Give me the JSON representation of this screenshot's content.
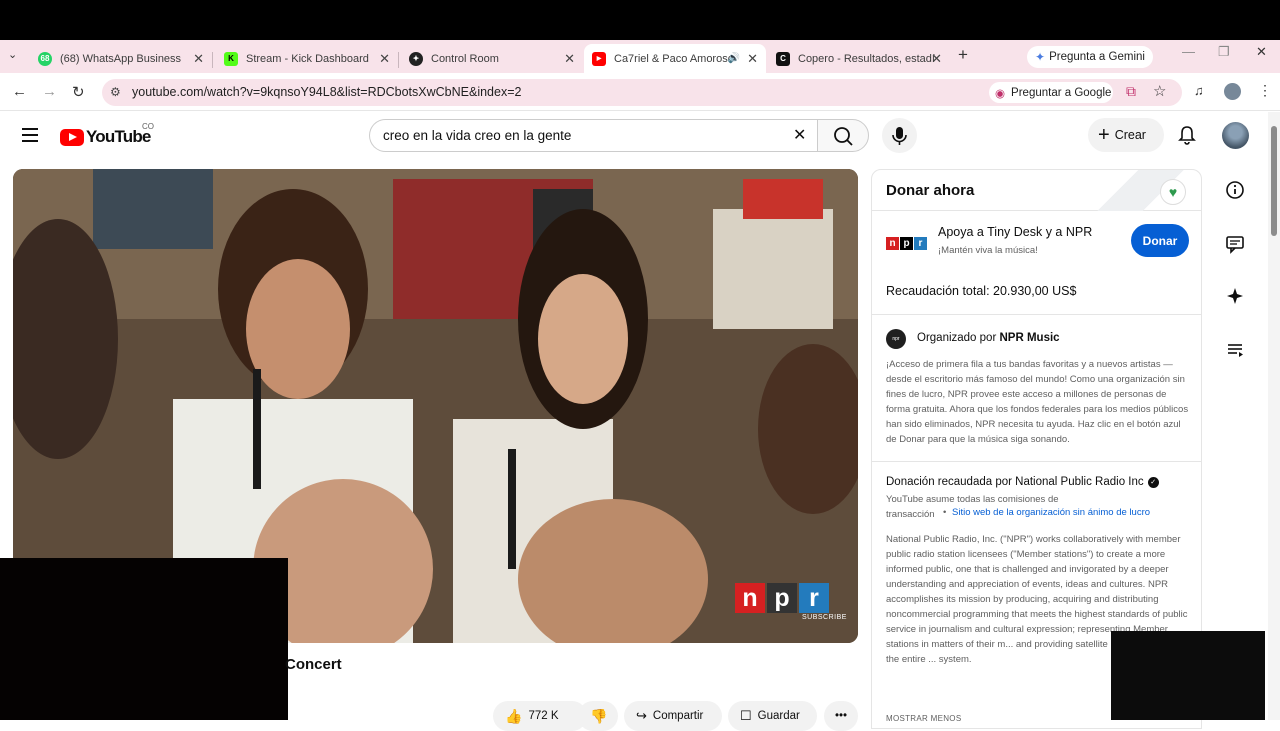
{
  "browser": {
    "tabs": [
      {
        "title": "(68) WhatsApp Business",
        "favicon_color": "#25d366",
        "favicon_text": "68"
      },
      {
        "title": "Stream - Kick Dashboard",
        "favicon_color": "#53fc18",
        "favicon_text": "K"
      },
      {
        "title": "Control Room",
        "favicon_color": "#222222",
        "favicon_text": "✦"
      },
      {
        "title": "Ca7riel & Paco Amoroso",
        "favicon_color": "#ff0000",
        "favicon_text": "▶",
        "active": true
      },
      {
        "title": "Copero - Resultados, estadí",
        "favicon_color": "#111111",
        "favicon_text": "C"
      }
    ],
    "new_tab": "+",
    "gemini": "Pregunta a Gemini",
    "url": "youtube.com/watch?v=9kqnsoY94L8&list=RDCbotsXwCbNE&index=2",
    "google_ask": "Preguntar a Google"
  },
  "youtube": {
    "logo_text": "YouTube",
    "country": "CO",
    "search_value": "creo en la vida creo en la gente",
    "create_label": "Crear"
  },
  "video": {
    "title_fragment": "Concert",
    "watermark": [
      "n",
      "p",
      "r"
    ],
    "watermark_sub": "SUBSCRIBE",
    "likes": "772 K",
    "share": "Compartir",
    "save": "Guardar"
  },
  "donation_panel": {
    "title": "Donar ahora",
    "support": "Apoya a Tiny Desk y a NPR",
    "tagline": "¡Mantén viva la música!",
    "donate_button": "Donar",
    "total": "Recaudación total: 20.930,00 US$",
    "organized_prefix": "Organizado por",
    "organizer": "NPR Music",
    "description": "¡Acceso de primera fila a tus bandas favoritas y a nuevos artistas — desde el escritorio más famoso del mundo! Como una organización sin fines de lucro, NPR provee este acceso a millones de personas de forma gratuita. Ahora que los fondos federales para los medios públicos han sido eliminados, NPR necesita tu ayuda. Haz clic en el botón azul de Donar para que la música siga sonando.",
    "raised_by": "Donación recaudada por National Public Radio Inc",
    "fees": "YouTube asume todas las comisiones de transacción",
    "org_link": "Sitio web de la organización sin ánimo de lucro",
    "npr_about": "National Public Radio, Inc. (\"NPR\") works collaboratively with member public radio station licensees (\"Member stations\") to create a more informed public, one that is challenged and invigorated by a deeper understanding and appreciation of events, ideas and cultures. NPR accomplishes its mission by producing, acquiring and distributing noncommercial programming that meets the highest standards of public service in journalism and cultural expression; representing Member stations in matters of their m... and providing satellite interconnection for the entire ... system.",
    "show_less": "MOSTRAR MENOS"
  },
  "colors": {
    "tabstrip": "#f8e3ea",
    "youtube_red": "#ff0000",
    "donate_blue": "#065fd4",
    "npr_n": "#d62021",
    "npr_p": "#000000",
    "npr_r": "#237bbd"
  }
}
